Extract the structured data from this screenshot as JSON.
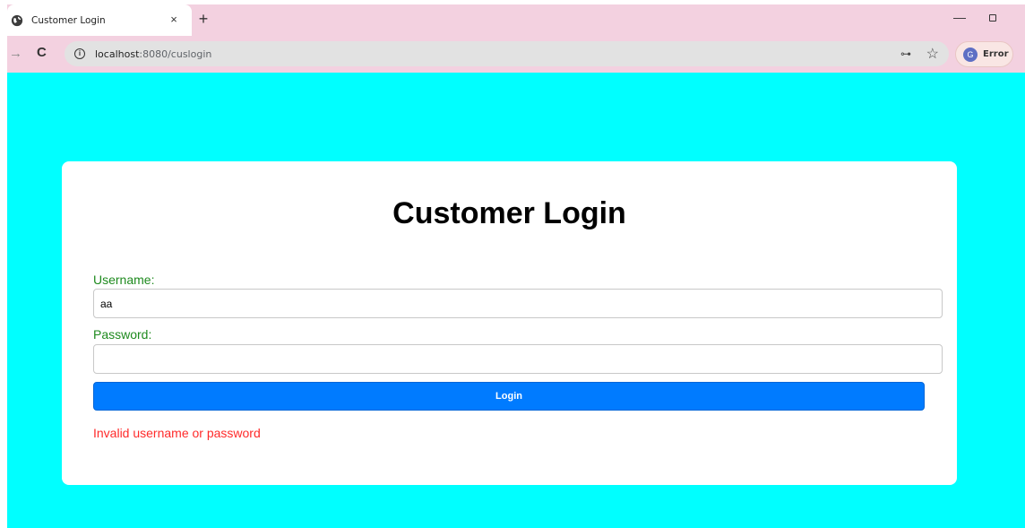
{
  "browser": {
    "tab_title": "Customer Login",
    "tab_close": "×",
    "new_tab": "+",
    "url_host": "localhost",
    "url_path": ":8080/cuslogin",
    "profile_initial": "G",
    "profile_label": "Error",
    "icons": {
      "tab": "globe-icon",
      "back": "arrow-right-icon",
      "reload": "reload-icon",
      "site_info": "info-icon",
      "password": "key-icon",
      "bookmark": "star-icon",
      "minimize": "minimize-icon",
      "restore": "restore-icon"
    }
  },
  "page": {
    "background_color": "#00ffff",
    "title": "Customer Login",
    "username_label": "Username:",
    "username_value": "aa",
    "password_label": "Password:",
    "password_value": "",
    "login_label": "Login",
    "error_message": "Invalid username or password",
    "colors": {
      "label": "#1e8a1e",
      "button": "#007bff",
      "error": "#ff2a2a"
    }
  }
}
